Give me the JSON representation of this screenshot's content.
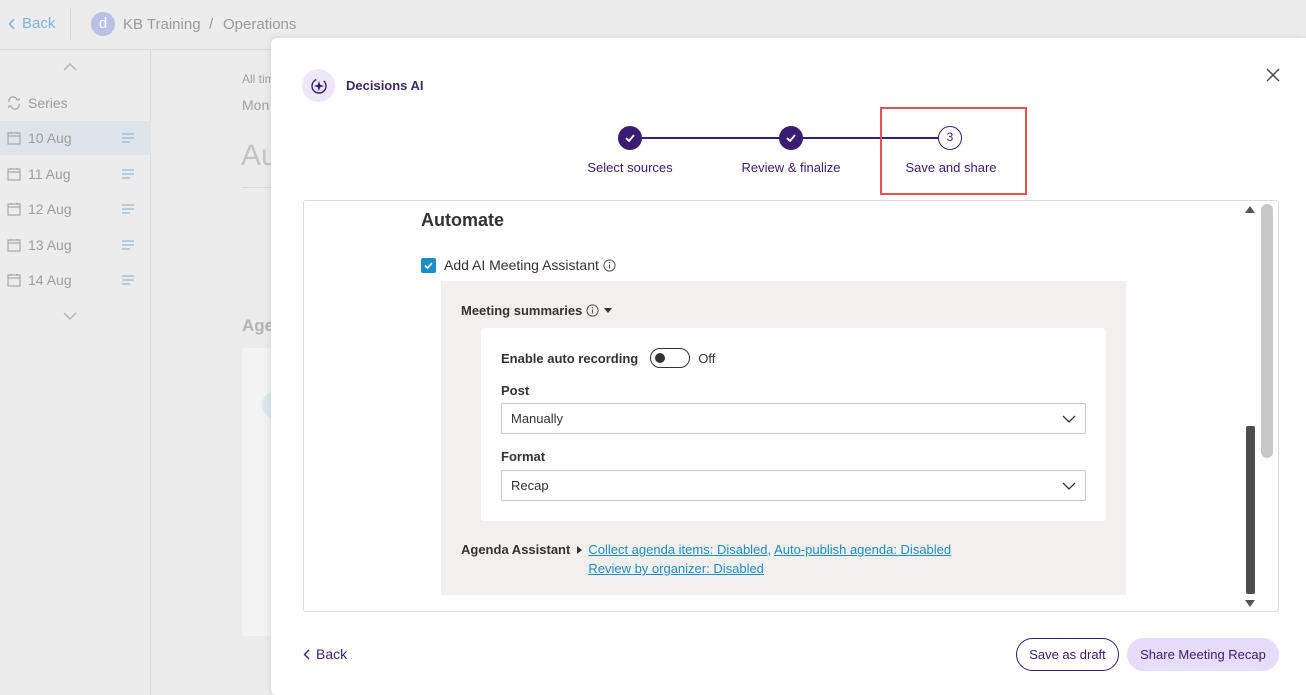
{
  "topbar": {
    "back_label": "Back",
    "workspace_initial": "d",
    "workspace_name": "KB Training",
    "separator": "/",
    "section": "Operations"
  },
  "sidebar": {
    "series_label": "Series",
    "dates": [
      {
        "label": "10 Aug",
        "active": true
      },
      {
        "label": "11 Aug",
        "active": false
      },
      {
        "label": "12 Aug",
        "active": false
      },
      {
        "label": "13 Aug",
        "active": false
      },
      {
        "label": "14 Aug",
        "active": false
      }
    ]
  },
  "background": {
    "line1": "All tim",
    "line2": "Mon",
    "heading": "Au",
    "agenda": "Age"
  },
  "modal": {
    "brand": "Decisions AI",
    "steps": [
      {
        "label": "Select sources",
        "state": "done"
      },
      {
        "label": "Review & finalize",
        "state": "done"
      },
      {
        "label": "Save and share",
        "state": "current",
        "number": "3"
      }
    ],
    "automate": {
      "title": "Automate",
      "assistant_checkbox_label": "Add AI Meeting Assistant",
      "assistant_checked": true,
      "meeting_summaries_label": "Meeting summaries",
      "auto_recording_label": "Enable auto recording",
      "auto_recording_state": "Off",
      "post_label": "Post",
      "post_value": "Manually",
      "format_label": "Format",
      "format_value": "Recap",
      "agenda_assistant_label": "Agenda Assistant",
      "agenda_links": {
        "collect": "Collect agenda items: Disabled",
        "autopublish": "Auto-publish agenda: Disabled",
        "review": "Review by organizer: Disabled"
      }
    },
    "footer": {
      "back_label": "Back",
      "save_draft_label": "Save as draft",
      "share_label": "Share Meeting Recap"
    }
  },
  "colors": {
    "accent_purple": "#3a1c71",
    "link_blue": "#1f8dc4",
    "highlight_red": "#e05353",
    "share_button_bg": "#e7dcf9"
  }
}
